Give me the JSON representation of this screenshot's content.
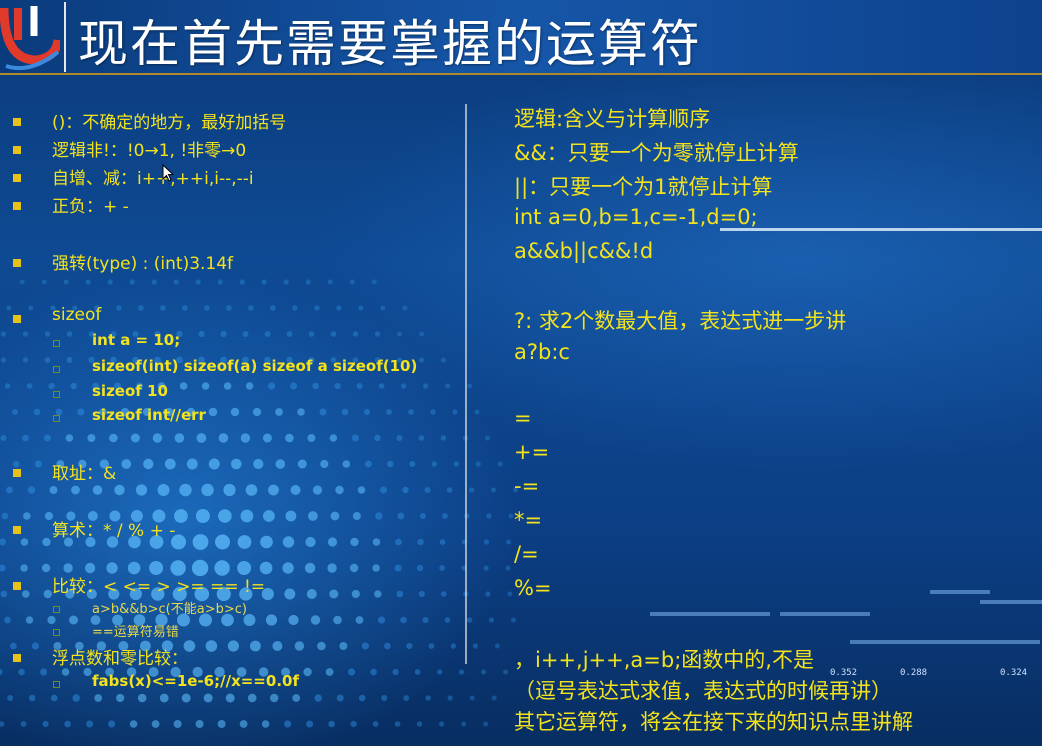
{
  "title": "现在首先需要掌握的运算符",
  "colors": {
    "accent": "#f4e31c",
    "background": "#0e4a93",
    "title": "#ffffff"
  },
  "left": {
    "paren": "()：不确定的地方，最好加括号",
    "not": "逻辑非!：!0→1, !非零→0",
    "incdec": "自增、减：i++,++i,i--,--i",
    "sign": "正负：+ -",
    "cast": "强转(type) : (int)3.14f",
    "sizeof": "sizeof",
    "sizeof_sub": [
      "int a = 10;",
      "sizeof(int) sizeof(a)  sizeof a sizeof(10)",
      "sizeof 10",
      "sizeof int//err"
    ],
    "addr": "取址：&",
    "arith": "算术：* / % + -",
    "compare": "比较：< <= > >=  ==  !=",
    "compare_sub": [
      "a>b&&b>c(不能a>b>c)",
      "==运算符易错"
    ],
    "float": "浮点数和零比较：",
    "float_sub": "fabs(x)<=1e-6;//x==0.0f"
  },
  "right": {
    "logic_title": "逻辑:含义与计算顺序",
    "and": "&&：只要一个为零就停止计算",
    "or": "||：只要一个为1就停止计算",
    "decl": "int a=0,b=1,c=-1,d=0;",
    "expr": "a&&b||c&&!d",
    "ternary": "?:  求2个数最大值，表达式进一步讲",
    "ternary_ex": "a?b:c",
    "assign": [
      "=",
      "+=",
      "-=",
      "*=",
      "/=",
      "%="
    ],
    "comma": "，i++,j++,a=b;函数中的,不是",
    "comma_note": "（逗号表达式求值，表达式的时候再讲）",
    "other": "其它运算符，将会在接下来的知识点里讲解"
  },
  "deco_numbers": [
    "0.352",
    "0.288",
    "0.324"
  ]
}
